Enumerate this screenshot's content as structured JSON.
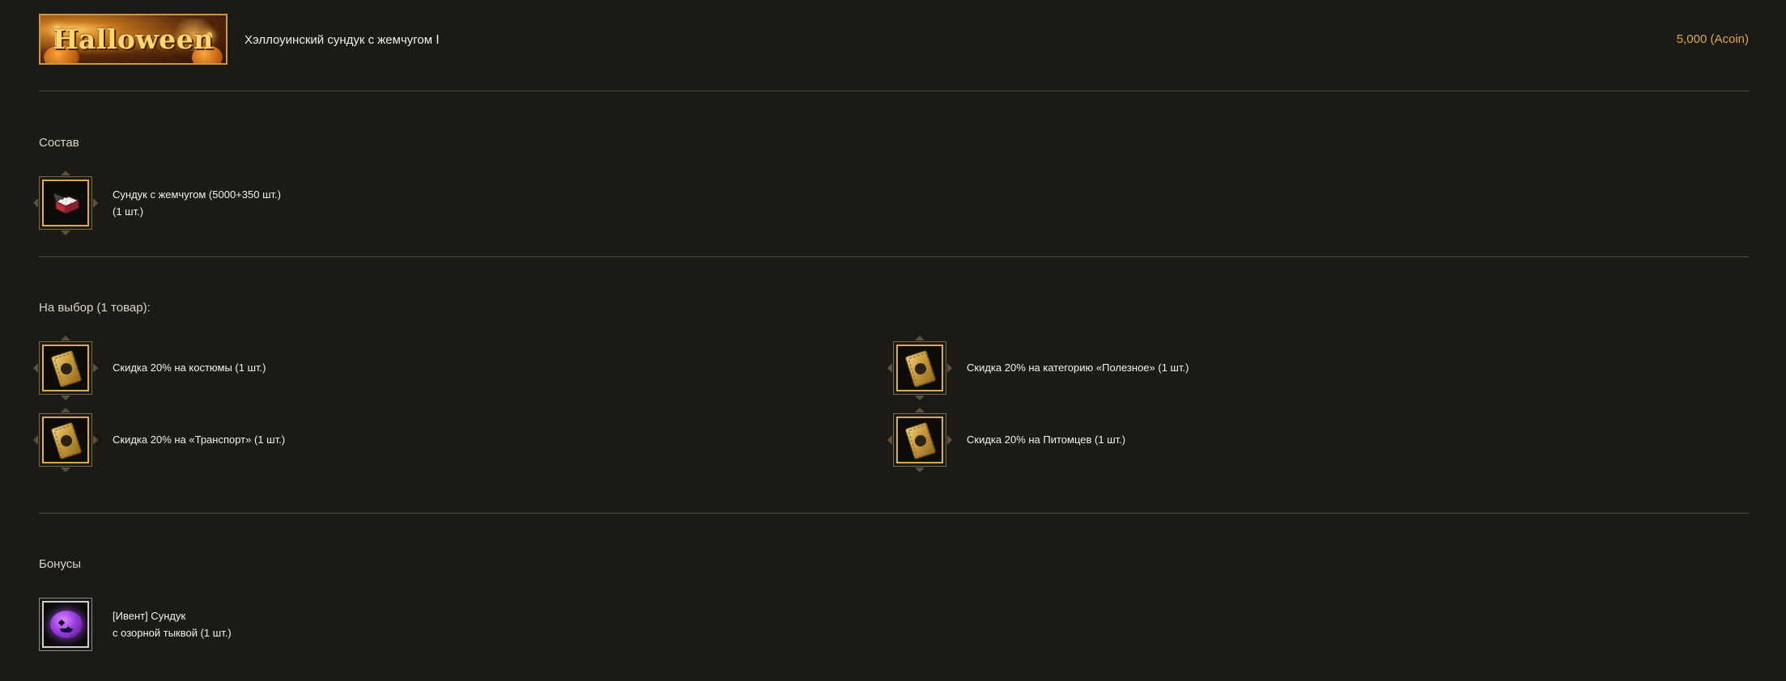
{
  "header": {
    "banner_title": "Halloween",
    "product_name": "Хэллоуинский сундук с жемчугом Ⅰ",
    "price": "5,000 (Acoin)"
  },
  "contents": {
    "title": "Состав",
    "items": [
      {
        "line1": "Сундук с жемчугом (5000+350 шт.)",
        "line2": "(1 шт.)",
        "icon": "pearl-chest-icon"
      }
    ]
  },
  "choice": {
    "title": "На выбор (1 товар):",
    "items": [
      {
        "label": "Скидка 20% на костюмы (1 шт.)",
        "icon": "discount-coupon-icon"
      },
      {
        "label": "Скидка 20% на категорию «Полезное» (1 шт.)",
        "icon": "discount-coupon-icon"
      },
      {
        "label": "Скидка 20% на «Транспорт» (1 шт.)",
        "icon": "discount-coupon-icon"
      },
      {
        "label": "Скидка 20% на Питомцев (1 шт.)",
        "icon": "discount-coupon-icon"
      }
    ]
  },
  "bonuses": {
    "title": "Бонусы",
    "items": [
      {
        "line1": "[Ивент] Сундук",
        "line2": "с озорной тыквой (1 шт.)",
        "icon": "mischievous-pumpkin-chest-icon"
      }
    ]
  },
  "colors": {
    "background": "#1b1a14",
    "price": "#d9a94a",
    "slot_border_gold": "#d7ad56",
    "divider": "#4d4a3d"
  }
}
